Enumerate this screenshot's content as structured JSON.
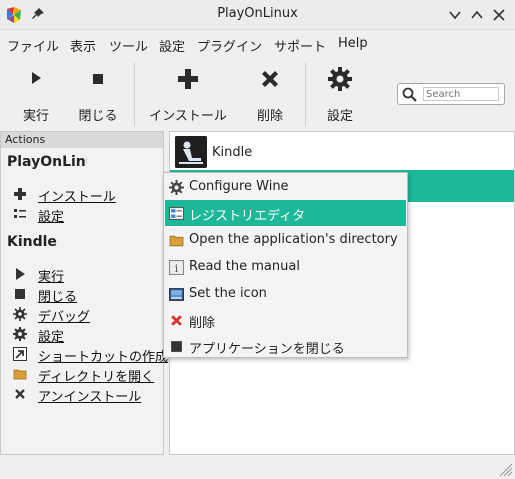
{
  "window": {
    "title": "PlayOnLinux"
  },
  "menubar": {
    "items": [
      "ファイル",
      "表示",
      "ツール",
      "設定",
      "プラグイン",
      "サポート",
      "Help"
    ]
  },
  "toolbar": {
    "run": "実行",
    "close": "閉じる",
    "install": "インストール",
    "remove": "削除",
    "settings": "設定",
    "search_placeholder": "Search"
  },
  "actions": {
    "header": "Actions",
    "playonlinux_title": "PlayOnLinux",
    "general": [
      "インストール",
      "設定"
    ],
    "app_title": "Kindle",
    "app_actions": [
      "実行",
      "閉じる",
      "デバッグ",
      "設定",
      "ショートカットの作成",
      "ディレクトリを開く",
      "アンインストール"
    ]
  },
  "applist": {
    "apps": [
      "Kindle"
    ]
  },
  "context_menu": {
    "items": [
      "Configure Wine",
      "レジストリエディタ",
      "Open the application's directory",
      "Read the manual",
      "Set the icon",
      "削除",
      "アプリケーションを閉じる"
    ],
    "active_index": 1
  },
  "colors": {
    "accent": "#1db899"
  }
}
